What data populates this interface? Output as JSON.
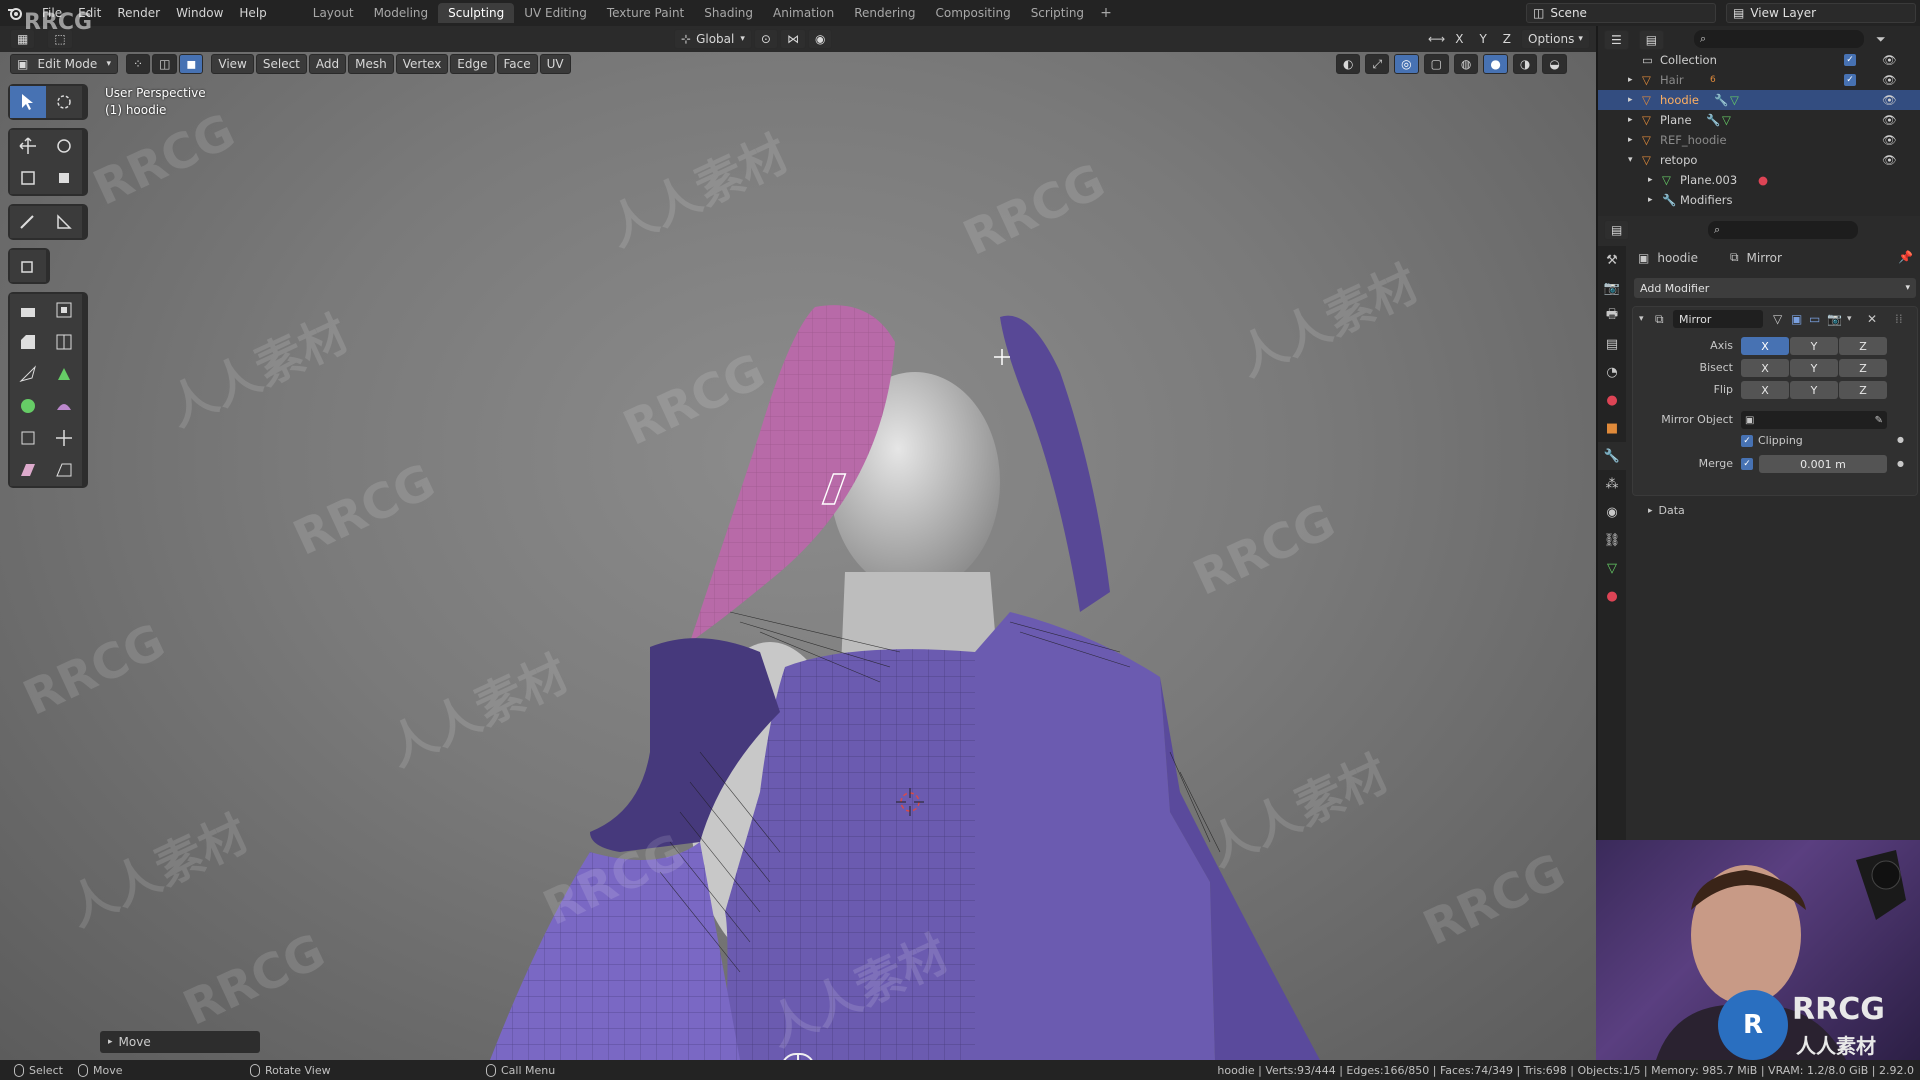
{
  "topbar": {
    "menus": [
      "File",
      "Edit",
      "Render",
      "Window",
      "Help"
    ],
    "workspaces": [
      "Layout",
      "Modeling",
      "Sculpting",
      "UV Editing",
      "Texture Paint",
      "Shading",
      "Animation",
      "Rendering",
      "Compositing",
      "Scripting"
    ],
    "active_workspace": "Sculpting",
    "scene": "Scene",
    "view_layer": "View Layer",
    "logo_text": "RRCG"
  },
  "viewport_header": {
    "mode": "Edit Mode",
    "menus": [
      "View",
      "Select",
      "Add",
      "Mesh",
      "Vertex",
      "Edge",
      "Face",
      "UV"
    ],
    "transform_orientation": "Global",
    "axis_labels": [
      "X",
      "Y",
      "Z"
    ],
    "options_label": "Options"
  },
  "viewport": {
    "perspective_label": "User Perspective",
    "object_label": "(1) hoodie",
    "last_operator": "Move"
  },
  "outliner": {
    "rows": [
      {
        "name": "Collection",
        "dim": false
      },
      {
        "name": "Hair",
        "dim": true
      },
      {
        "name": "hoodie",
        "dim": false
      },
      {
        "name": "Plane",
        "dim": false
      },
      {
        "name": "REF_hoodie",
        "dim": true
      },
      {
        "name": "retopo",
        "dim": false
      },
      {
        "name": "Plane.003",
        "dim": false
      },
      {
        "name": "Modifiers",
        "dim": false
      }
    ],
    "hair_count": "6"
  },
  "properties": {
    "object_name": "hoodie",
    "modifier_breadcrumb": "Mirror",
    "add_modifier": "Add Modifier",
    "modifier_name": "Mirror",
    "axis_label": "Axis",
    "bisect_label": "Bisect",
    "flip_label": "Flip",
    "mirror_object_label": "Mirror Object",
    "clipping_label": "Clipping",
    "merge_label": "Merge",
    "merge_value": "0.001 m",
    "data_label": "Data",
    "xyz": [
      "X",
      "Y",
      "Z"
    ]
  },
  "webcam": {
    "brand": "RRCG",
    "brand_sub": "人人素材"
  },
  "statusbar": {
    "select": "Select",
    "move": "Move",
    "rotate": "Rotate View",
    "call_menu": "Call Menu",
    "stats": "hoodie | Verts:93/444 | Edges:166/850 | Faces:74/349 | Tris:698 | Objects:1/5 | Memory: 985.7 MiB | VRAM: 1.2/8.0 GiB | 2.92.0"
  },
  "colors": {
    "accent": "#4772b3",
    "mesh_purple": "#6b5bb0",
    "mesh_selected": "#b86aa8"
  }
}
